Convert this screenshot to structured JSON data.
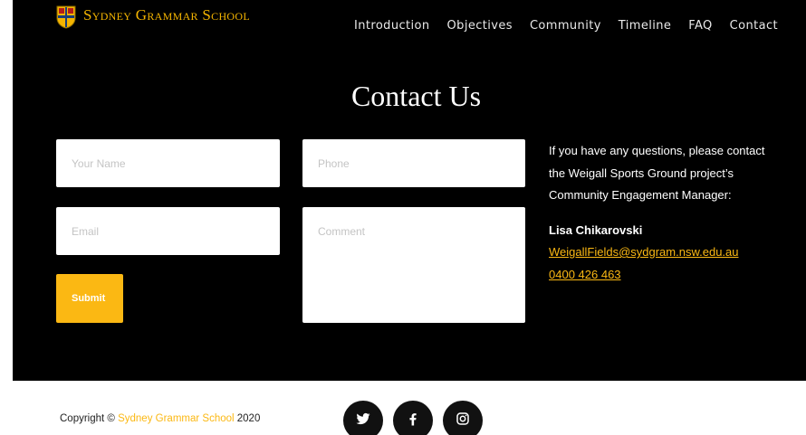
{
  "brand": {
    "name": "Sydney Grammar School",
    "accent_color": "#fbb813"
  },
  "nav": {
    "items": [
      "Introduction",
      "Objectives",
      "Community",
      "Timeline",
      "FAQ",
      "Contact"
    ]
  },
  "contact": {
    "heading": "Contact Us",
    "form": {
      "name_placeholder": "Your Name",
      "phone_placeholder": "Phone",
      "email_placeholder": "Email",
      "comment_placeholder": "Comment",
      "submit_label": "Submit"
    },
    "info": {
      "text": "If you have any questions, please contact the Weigall Sports Ground project’s Community Engagement Manager:",
      "person": "Lisa Chikarovski",
      "email": "WeigallFields@sydgram.nsw.edu.au",
      "phone": "0400 426 463"
    }
  },
  "footer": {
    "copyright_prefix": "Copyright © ",
    "copyright_link": "Sydney Grammar School",
    "copyright_year": " 2020",
    "social_icons": [
      "twitter-icon",
      "facebook-icon",
      "instagram-icon"
    ]
  }
}
